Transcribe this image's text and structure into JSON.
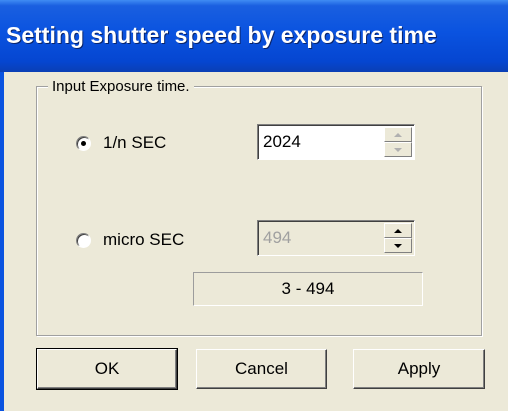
{
  "window": {
    "title": "Setting shutter speed by exposure time"
  },
  "group": {
    "legend": "Input Exposure time."
  },
  "options": [
    {
      "label": "1/n SEC",
      "selected": true,
      "value": "2024"
    },
    {
      "label": "micro SEC",
      "selected": false,
      "value": "494"
    }
  ],
  "range_text": "3 - 494",
  "buttons": {
    "ok": "OK",
    "cancel": "Cancel",
    "apply": "Apply"
  },
  "colors": {
    "title_bar": "#0a53e0",
    "dialog_face": "#ece9d8",
    "disabled_text": "#a0a0a0"
  },
  "icons": {
    "spin_up": "triangle-up",
    "spin_down": "triangle-down"
  }
}
